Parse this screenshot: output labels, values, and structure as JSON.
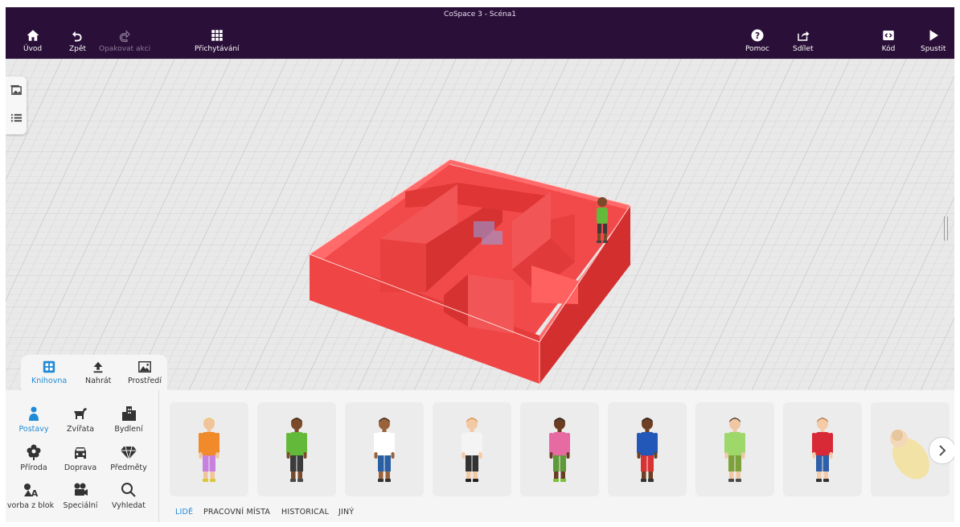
{
  "window_title": "CoSpace 3 - Scéna1",
  "toolbar": {
    "home": "Úvod",
    "undo": "Zpět",
    "redo": "Opakovat akci",
    "snap": "Přichytávání",
    "help": "Pomoc",
    "share": "Sdílet",
    "code": "Kód",
    "run": "Spustit"
  },
  "library_tabs": [
    {
      "label": "Knihovna",
      "icon": "library-icon",
      "active": true
    },
    {
      "label": "Nahrát",
      "icon": "upload-icon",
      "active": false
    },
    {
      "label": "Prostředí",
      "icon": "environment-icon",
      "active": false
    }
  ],
  "categories": [
    {
      "label": "Postavy",
      "icon": "person-icon",
      "active": true
    },
    {
      "label": "Zvířata",
      "icon": "dog-icon",
      "active": false
    },
    {
      "label": "Bydlení",
      "icon": "buildings-icon",
      "active": false
    },
    {
      "label": "Příroda",
      "icon": "flower-icon",
      "active": false
    },
    {
      "label": "Doprava",
      "icon": "car-icon",
      "active": false
    },
    {
      "label": "Předměty",
      "icon": "gem-icon",
      "active": false
    },
    {
      "label": "vorba z blok",
      "icon": "build-blocks-icon",
      "active": false
    },
    {
      "label": "Speciální",
      "icon": "camera-icon",
      "active": false
    },
    {
      "label": "Vyhledat",
      "icon": "search-icon",
      "active": false
    }
  ],
  "characters": [
    {
      "name": "character-1",
      "skin": "#f2c49c",
      "hair": "#e7c96a",
      "shirt": "#f08a2a",
      "pants": "#c981e0",
      "shoes": "#d9c93a"
    },
    {
      "name": "character-2",
      "skin": "#7a4a2a",
      "hair": "#3a2316",
      "shirt": "#63b93a",
      "pants": "#3b3b3b",
      "shoes": "#4a4a4a"
    },
    {
      "name": "character-3",
      "skin": "#9a6239",
      "hair": "#2b1d14",
      "shirt": "#ffffff",
      "pants": "#2b5fa3",
      "shoes": "#333333"
    },
    {
      "name": "character-4",
      "skin": "#f3c9a4",
      "hair": "#d8893a",
      "shirt": "#f4f4f4",
      "pants": "#333333",
      "shoes": "#222222"
    },
    {
      "name": "character-5",
      "skin": "#6a3d22",
      "hair": "#1e1410",
      "shirt": "#e86aa2",
      "pants": "#5f9a3a",
      "shoes": "#7ac13a"
    },
    {
      "name": "character-6",
      "skin": "#6e3f22",
      "hair": "#1e1410",
      "shirt": "#2357b8",
      "pants": "#d83232",
      "shoes": "#333333"
    },
    {
      "name": "character-7",
      "skin": "#f0c7a2",
      "hair": "#3a2a1e",
      "shirt": "#9fd86a",
      "pants": "#7ea23a",
      "shoes": "#4a4a4a"
    },
    {
      "name": "character-8",
      "skin": "#f4cba6",
      "hair": "#b36a3a",
      "shirt": "#d82a36",
      "pants": "#2f5fa8",
      "shoes": "#333333"
    },
    {
      "name": "character-9-baby",
      "skin": "#f3d9b8",
      "hair": "#e0b88a",
      "shirt": "#f3e2a6",
      "pants": "#f3e2a6",
      "shoes": "#f3e2a6"
    }
  ],
  "subtabs": [
    {
      "label": "LIDÉ",
      "active": true
    },
    {
      "label": "PRACOVNÍ MÍSTA",
      "active": false
    },
    {
      "label": "HISTORICAL",
      "active": false
    },
    {
      "label": "JINÝ",
      "active": false
    }
  ],
  "colors": {
    "topbar": "#2a0f38",
    "accent": "#1f8ad6",
    "maze": "#f24a4a"
  }
}
